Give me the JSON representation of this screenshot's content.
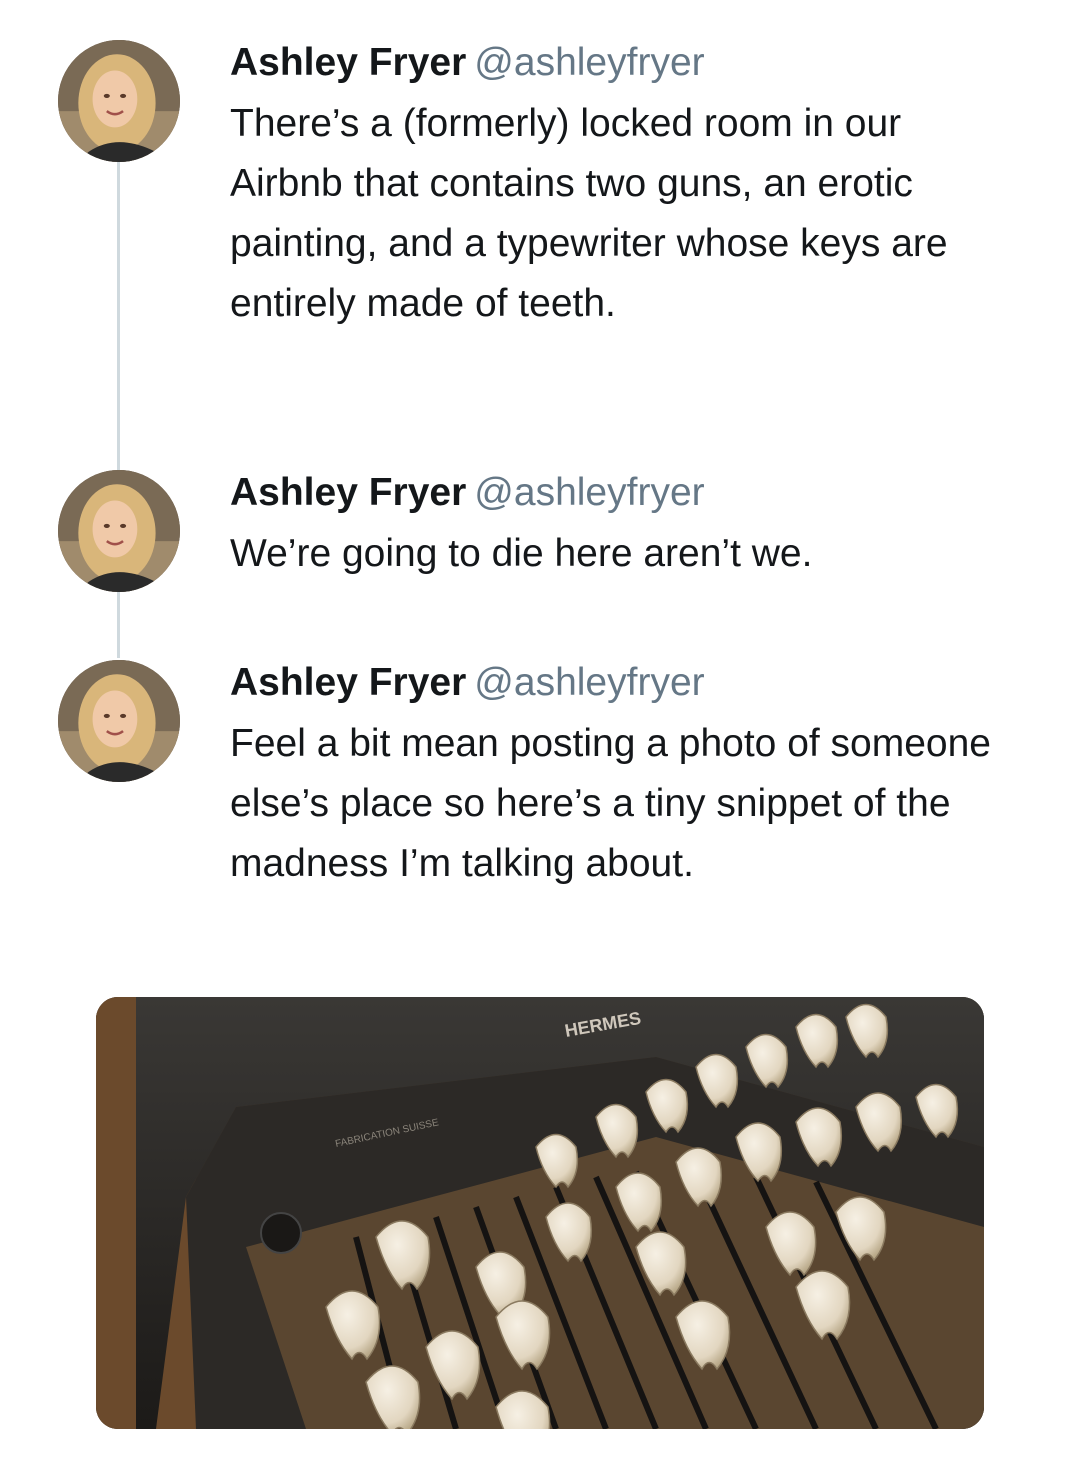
{
  "tweets": [
    {
      "name": "Ashley Fryer",
      "handle": "@ashleyfryer",
      "text": "There’s a (formerly) locked room in our Airbnb that contains two guns, an erotic painting, and a typewriter whose keys are entirely made of teeth."
    },
    {
      "name": "Ashley Fryer",
      "handle": "@ashleyfryer",
      "text": "We’re going to die here aren’t we."
    },
    {
      "name": "Ashley Fryer",
      "handle": "@ashleyfryer",
      "text": "Feel a bit mean posting a photo of someone else’s place so here’s a tiny snippet of the madness I’m talking about."
    }
  ],
  "photo": {
    "brand": "HERMES",
    "label": "FABRICATION SUISSE"
  },
  "colors": {
    "handle": "#657786",
    "thread_line": "#cfd9de",
    "text": "#14171a"
  }
}
